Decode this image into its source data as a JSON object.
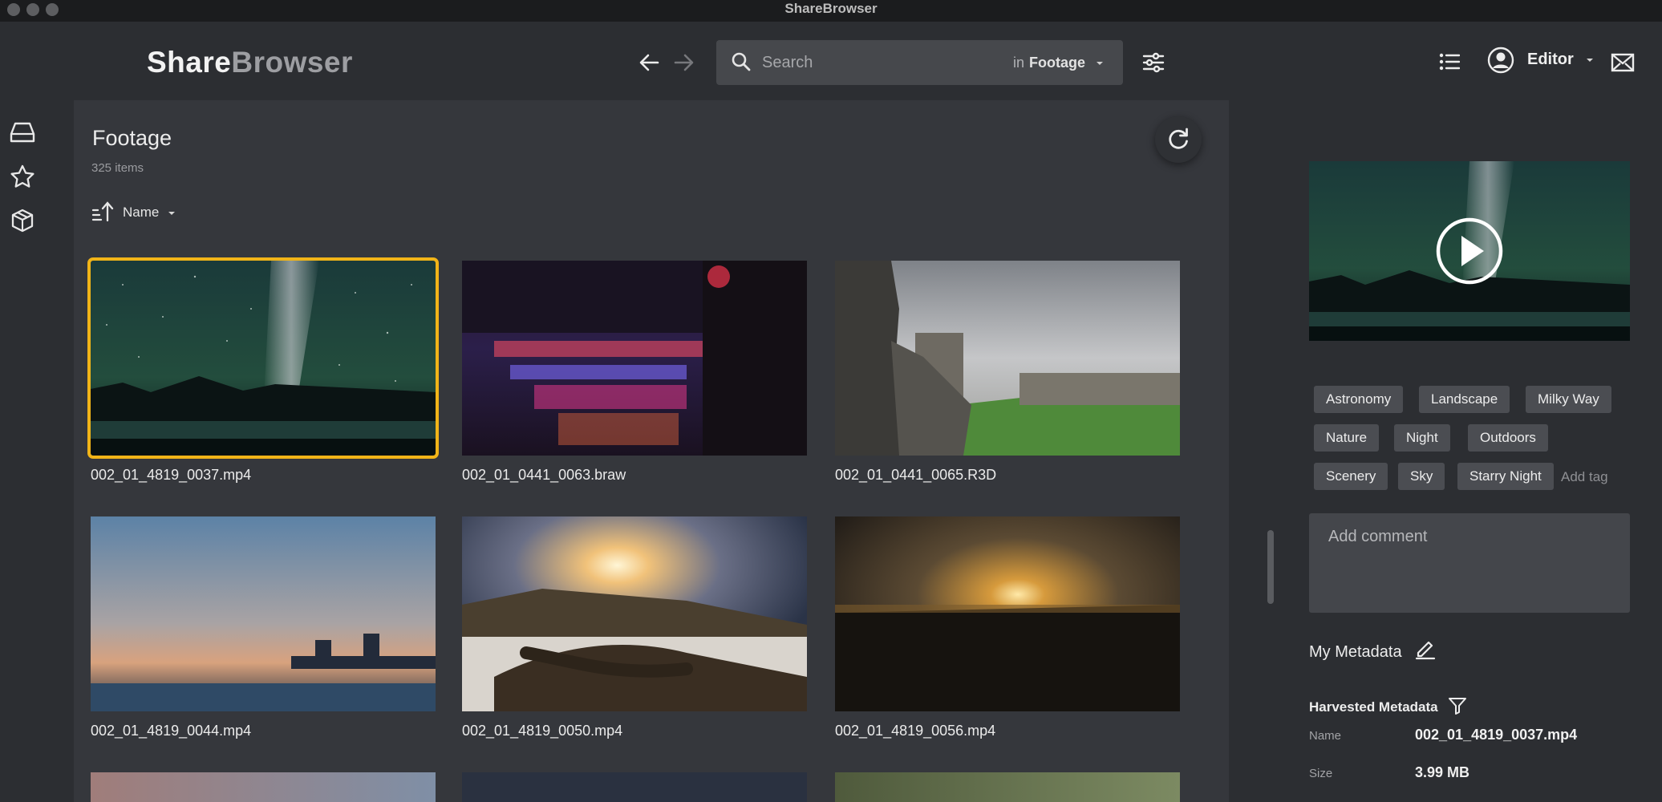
{
  "window": {
    "title": "ShareBrowser"
  },
  "header": {
    "logo_part1": "Share",
    "logo_part2": "Browser",
    "search": {
      "placeholder": "Search",
      "scope_prefix": "in",
      "scope_value": "Footage"
    },
    "user_label": "Editor",
    "icons": [
      "back-arrow-icon",
      "forward-arrow-icon",
      "search-icon",
      "chevron-down-icon",
      "filter-sliders-icon",
      "list-view-icon",
      "user-avatar-icon",
      "mail-icon"
    ]
  },
  "leftnav": {
    "icons": [
      "storage-drive-icon",
      "star-icon",
      "package-box-icon"
    ]
  },
  "content": {
    "folder_title": "Footage",
    "item_count": "325 items",
    "sort_label": "Name",
    "info_toggle": "i>",
    "tiles": [
      {
        "name": "002_01_4819_0037.mp4",
        "selected": true
      },
      {
        "name": "002_01_0441_0063.braw"
      },
      {
        "name": "002_01_0441_0065.R3D"
      },
      {
        "name": "002_01_4819_0044.mp4"
      },
      {
        "name": "002_01_4819_0050.mp4"
      },
      {
        "name": "002_01_4819_0056.mp4"
      }
    ]
  },
  "details": {
    "tags": [
      "Astronomy",
      "Landscape",
      "Milky Way",
      "Nature",
      "Night",
      "Outdoors",
      "Scenery",
      "Sky",
      "Starry Night"
    ],
    "add_tag": "Add tag",
    "comment_placeholder": "Add comment",
    "my_metadata": "My Metadata",
    "harvested_metadata": "Harvested Metadata",
    "fields": [
      {
        "key": "Name",
        "value": "002_01_4819_0037.mp4"
      },
      {
        "key": "Size",
        "value": "3.99 MB"
      }
    ]
  },
  "colors": {
    "selection": "#f1b418",
    "background": "#2c2e32",
    "content_bg": "#35373c",
    "tag_bg": "#4b4d52"
  }
}
